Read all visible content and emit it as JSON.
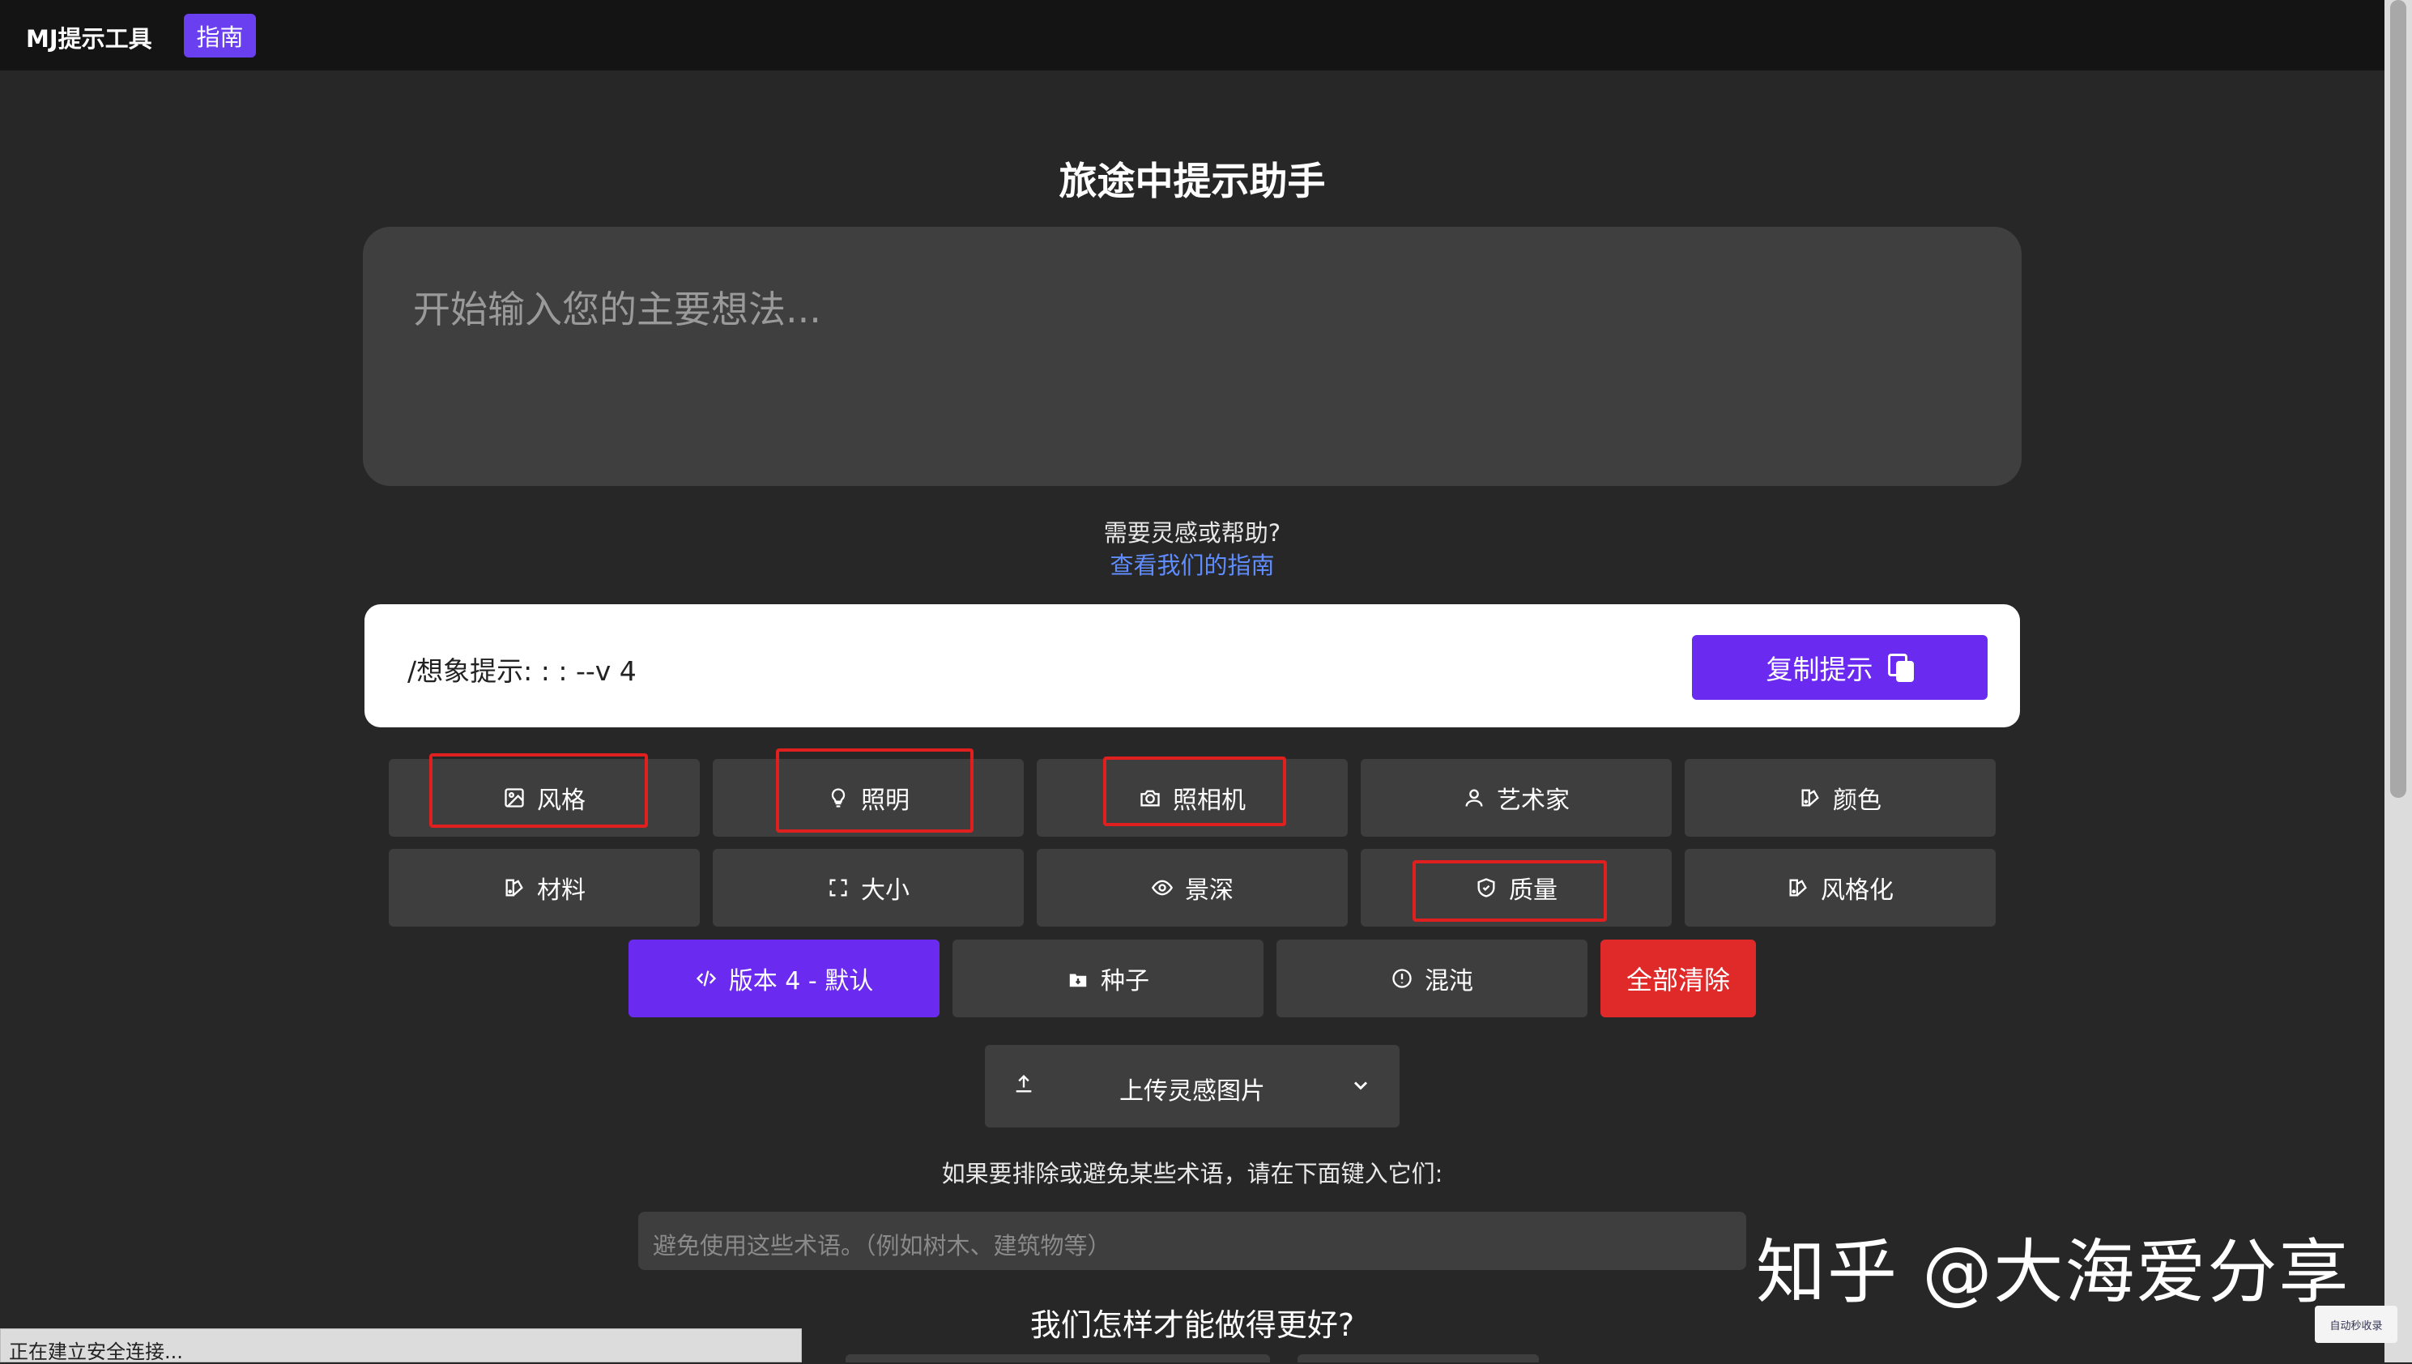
{
  "nav": {
    "brand": "MJ提示工具",
    "guide_label": "指南"
  },
  "main": {
    "title": "旅途中提示助手",
    "idea_placeholder": "开始输入您的主要想法...",
    "help_question": "需要灵感或帮助?",
    "help_link": "查看我们的指南"
  },
  "prompt": {
    "text": "/想象提示: : : --v 4",
    "copy_label": "复制提示"
  },
  "options": {
    "row1": [
      {
        "label": "风格",
        "icon": "image-icon"
      },
      {
        "label": "照明",
        "icon": "bulb-icon"
      },
      {
        "label": "照相机",
        "icon": "camera-icon"
      },
      {
        "label": "艺术家",
        "icon": "users-icon"
      },
      {
        "label": "颜色",
        "icon": "palette-icon"
      }
    ],
    "row2": [
      {
        "label": "材料",
        "icon": "palette-icon"
      },
      {
        "label": "大小",
        "icon": "expand-icon"
      },
      {
        "label": "景深",
        "icon": "eye-icon"
      },
      {
        "label": "质量",
        "icon": "shield-icon"
      },
      {
        "label": "风格化",
        "icon": "palette-icon"
      }
    ],
    "row3": [
      {
        "label": "版本 4 - 默认",
        "icon": "code-icon"
      },
      {
        "label": "种子",
        "icon": "seed-icon"
      },
      {
        "label": "混沌",
        "icon": "alert-circle-icon"
      },
      {
        "label": "全部清除"
      }
    ]
  },
  "upload": {
    "label": "上传灵感图片"
  },
  "exclude": {
    "label": "如果要排除或避免某些术语，请在下面键入它们:",
    "placeholder": "避免使用这些术语。（例如树木、建筑物等）"
  },
  "feedback": {
    "title": "我们怎样才能做得更好?"
  },
  "watermark": "知乎 @大海爱分享",
  "status": "正在建立安全连接...",
  "corner_logo": "自动秒收录",
  "colors": {
    "accent": "#6a2af0",
    "danger": "#e02a2a",
    "highlight": "#e01f1f",
    "background": "#272727"
  }
}
